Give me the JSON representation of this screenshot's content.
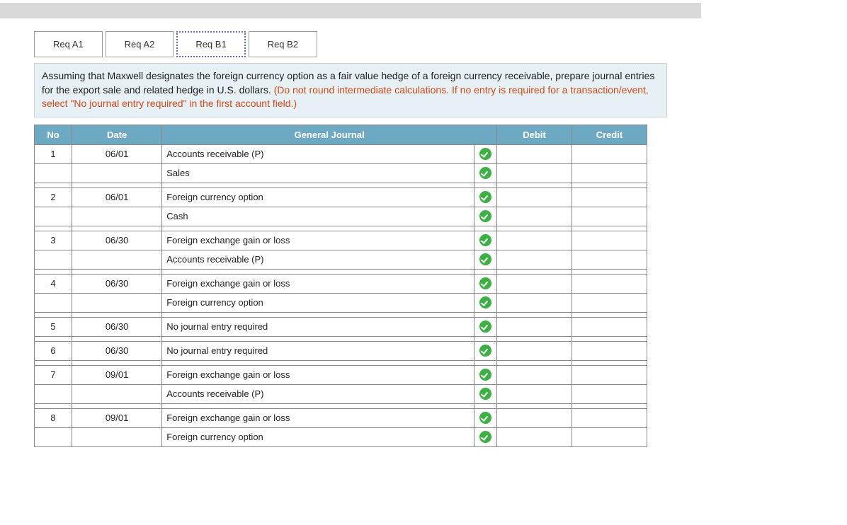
{
  "tabs": [
    {
      "label": "Req A1",
      "active": false
    },
    {
      "label": "Req A2",
      "active": false
    },
    {
      "label": "Req B1",
      "active": true
    },
    {
      "label": "Req B2",
      "active": false
    }
  ],
  "instruction": {
    "black": "Assuming that Maxwell designates the foreign currency option as a fair value hedge of a foreign currency receivable, prepare journal entries for the export sale and related hedge in U.S. dollars. ",
    "red": "(Do not round intermediate calculations. If no entry is required for a transaction/event, select \"No journal entry required\" in the first account field.)"
  },
  "headers": {
    "no": "No",
    "date": "Date",
    "general": "General Journal",
    "debit": "Debit",
    "credit": "Credit"
  },
  "entries": [
    {
      "no": "1",
      "date": "06/01",
      "rows": [
        {
          "account": "Accounts receivable (P)",
          "check": true
        },
        {
          "account": "Sales",
          "check": true
        }
      ]
    },
    {
      "no": "2",
      "date": "06/01",
      "rows": [
        {
          "account": "Foreign currency option",
          "check": true
        },
        {
          "account": "Cash",
          "check": true
        }
      ]
    },
    {
      "no": "3",
      "date": "06/30",
      "rows": [
        {
          "account": "Foreign exchange gain or loss",
          "check": true
        },
        {
          "account": "Accounts receivable (P)",
          "check": true
        }
      ]
    },
    {
      "no": "4",
      "date": "06/30",
      "rows": [
        {
          "account": "Foreign exchange gain or loss",
          "check": true
        },
        {
          "account": "Foreign currency option",
          "check": true
        }
      ]
    },
    {
      "no": "5",
      "date": "06/30",
      "rows": [
        {
          "account": "No journal entry required",
          "check": true
        }
      ]
    },
    {
      "no": "6",
      "date": "06/30",
      "rows": [
        {
          "account": "No journal entry required",
          "check": true
        }
      ]
    },
    {
      "no": "7",
      "date": "09/01",
      "rows": [
        {
          "account": "Foreign exchange gain or loss",
          "check": true
        },
        {
          "account": "Accounts receivable (P)",
          "check": true
        }
      ]
    },
    {
      "no": "8",
      "date": "09/01",
      "rows": [
        {
          "account": "Foreign exchange gain or loss",
          "check": true
        },
        {
          "account": "Foreign currency option",
          "check": true
        }
      ]
    }
  ]
}
